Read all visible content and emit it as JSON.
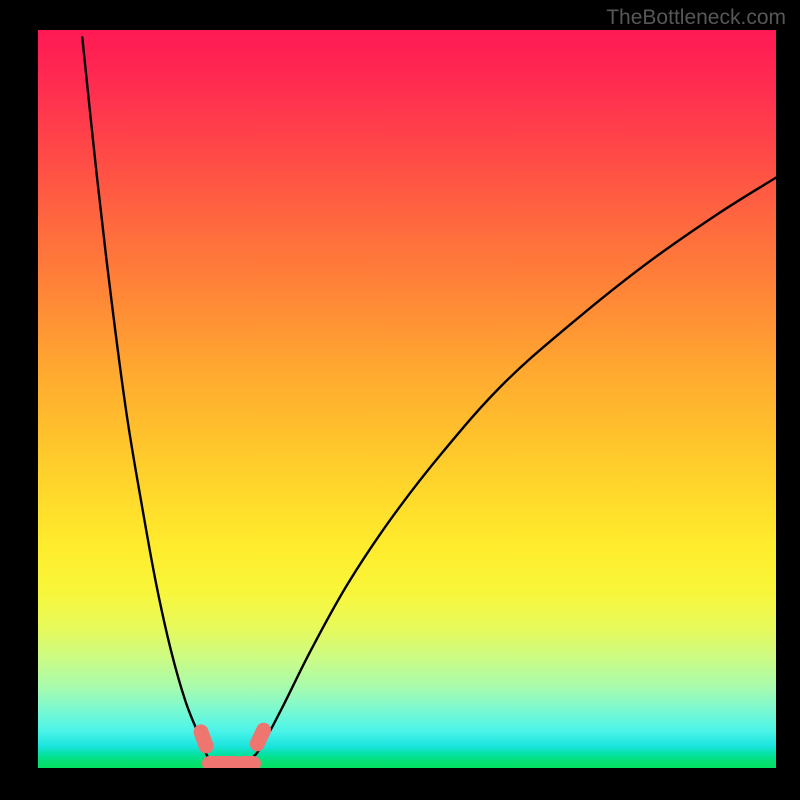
{
  "watermark": "TheBottleneck.com",
  "chart_data": {
    "type": "line",
    "title": "",
    "xlabel": "",
    "ylabel": "",
    "xlim": [
      0,
      100
    ],
    "ylim": [
      0,
      100
    ],
    "grid": false,
    "legend": false,
    "series": [
      {
        "name": "left-branch",
        "x": [
          6,
          8,
          10,
          12,
          14,
          16,
          18,
          20,
          22,
          23,
          24
        ],
        "y": [
          99,
          80,
          63,
          48,
          36,
          25,
          16,
          9,
          4,
          1.5,
          0.5
        ]
      },
      {
        "name": "right-branch",
        "x": [
          28,
          30,
          33,
          37,
          42,
          48,
          55,
          63,
          72,
          82,
          92,
          100
        ],
        "y": [
          0.5,
          2.5,
          8,
          16,
          25,
          34,
          43,
          52,
          60,
          68,
          75,
          80
        ]
      }
    ],
    "markers": [
      {
        "shape": "pill",
        "cx": 22.4,
        "cy": 4.0,
        "w": 2.0,
        "h": 4.0,
        "angle": -20
      },
      {
        "shape": "pill",
        "cx": 30.2,
        "cy": 4.2,
        "w": 2.0,
        "h": 4.0,
        "angle": 25
      },
      {
        "shape": "pill",
        "cx": 25.0,
        "cy": 0.6,
        "w": 5.5,
        "h": 2.0,
        "angle": 0
      },
      {
        "shape": "pill",
        "cx": 28.5,
        "cy": 0.6,
        "w": 3.5,
        "h": 2.0,
        "angle": 0
      }
    ]
  }
}
